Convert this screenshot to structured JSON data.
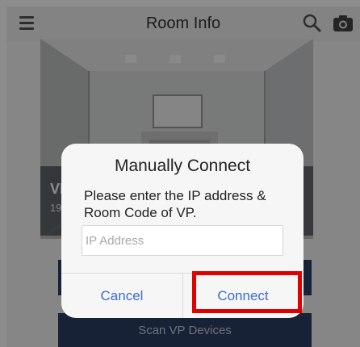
{
  "header": {
    "title": "Room Info",
    "icons": [
      "menu-icon",
      "search-icon",
      "camera-icon"
    ]
  },
  "room": {
    "name": "VP",
    "ip": "192"
  },
  "buttons": {
    "primary": "",
    "scan": "Scan VP Devices"
  },
  "dialog": {
    "title": "Manually Connect",
    "message": "Please enter the IP address & Room Code of VP.",
    "input_value": "",
    "input_placeholder": "IP Address",
    "cancel_label": "Cancel",
    "connect_label": "Connect"
  },
  "colors": {
    "accent": "#3b6ad8",
    "button_bg": "#2d3e63",
    "highlight": "#e00000"
  }
}
